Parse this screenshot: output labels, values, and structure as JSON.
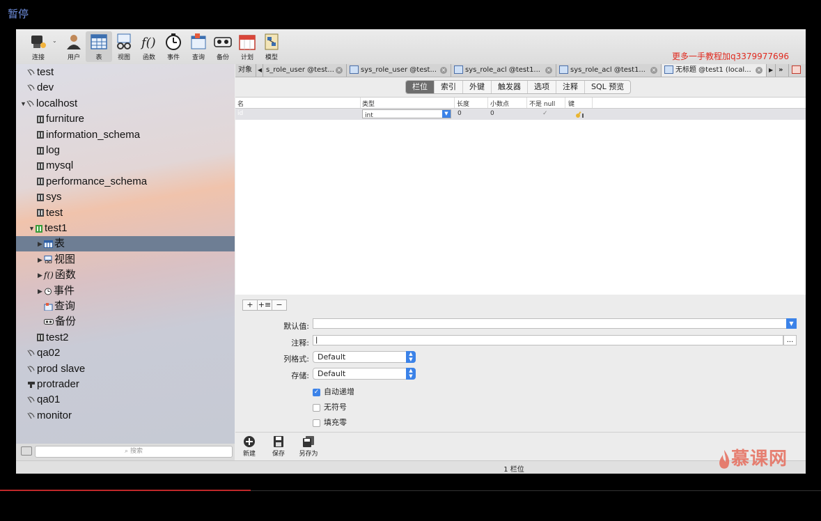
{
  "player": {
    "pause_label": "暂停",
    "progress": 0.305,
    "accent": "#c0282a"
  },
  "watermark": "更多一手教程加q3379977696",
  "toolbar": {
    "items": [
      {
        "label": "连接",
        "icon": "connect-icon"
      },
      {
        "label": "用户",
        "icon": "user-icon"
      },
      {
        "label": "表",
        "icon": "table-icon",
        "active": true
      },
      {
        "label": "视图",
        "icon": "view-icon"
      },
      {
        "label": "函数",
        "icon": "function-icon"
      },
      {
        "label": "事件",
        "icon": "event-icon"
      },
      {
        "label": "查询",
        "icon": "query-icon"
      },
      {
        "label": "备份",
        "icon": "backup-icon"
      },
      {
        "label": "计划",
        "icon": "schedule-icon"
      },
      {
        "label": "模型",
        "icon": "model-icon"
      }
    ]
  },
  "sidebar": {
    "items": [
      {
        "label": "test",
        "kind": "connection",
        "level": 0
      },
      {
        "label": "dev",
        "kind": "connection",
        "level": 0
      },
      {
        "label": "localhost",
        "kind": "connection",
        "level": 0,
        "expanded": true
      },
      {
        "label": "furniture",
        "kind": "database",
        "level": 1
      },
      {
        "label": "information_schema",
        "kind": "database",
        "level": 1
      },
      {
        "label": "log",
        "kind": "database",
        "level": 1
      },
      {
        "label": "mysql",
        "kind": "database",
        "level": 1
      },
      {
        "label": "performance_schema",
        "kind": "database",
        "level": 1
      },
      {
        "label": "sys",
        "kind": "database",
        "level": 1
      },
      {
        "label": "test",
        "kind": "database",
        "level": 1
      },
      {
        "label": "test1",
        "kind": "database-open",
        "level": 1,
        "expanded": true
      },
      {
        "label": "表",
        "kind": "tables",
        "level": 2,
        "selected": true
      },
      {
        "label": "视图",
        "kind": "views",
        "level": 2
      },
      {
        "label": "函数",
        "kind": "functions",
        "level": 2
      },
      {
        "label": "事件",
        "kind": "events",
        "level": 2
      },
      {
        "label": "查询",
        "kind": "queries",
        "level": 2
      },
      {
        "label": "备份",
        "kind": "backups",
        "level": 2
      },
      {
        "label": "test2",
        "kind": "database",
        "level": 1
      },
      {
        "label": "qa02",
        "kind": "connection",
        "level": 0
      },
      {
        "label": "prod slave",
        "kind": "connection",
        "level": 0
      },
      {
        "label": "protrader",
        "kind": "connection-alt",
        "level": 0
      },
      {
        "label": "qa01",
        "kind": "connection",
        "level": 0
      },
      {
        "label": "monitor",
        "kind": "connection",
        "level": 0
      }
    ],
    "search_placeholder": "搜索"
  },
  "tabs": {
    "objects_label": "对象",
    "items": [
      {
        "label": "s_role_user @test..."
      },
      {
        "label": "sys_role_user @test..."
      },
      {
        "label": "sys_role_acl @test1..."
      },
      {
        "label": "sys_role_acl @test1..."
      },
      {
        "label": "无标题 @test1 (local...",
        "active": true
      }
    ]
  },
  "segments": [
    "栏位",
    "索引",
    "外键",
    "触发器",
    "选项",
    "注释",
    "SQL 预览"
  ],
  "grid": {
    "headers": [
      "名",
      "类型",
      "长度",
      "小数点",
      "不是 null",
      "键"
    ],
    "rows": [
      {
        "name": "id",
        "type": "int",
        "length": "0",
        "decimals": "0",
        "not_null": true,
        "key": true
      }
    ]
  },
  "row_buttons": [
    "+",
    "+≡",
    "−"
  ],
  "props": {
    "default_label": "默认值:",
    "comment_label": "注释:",
    "format_label": "列格式:",
    "format_value": "Default",
    "storage_label": "存储:",
    "storage_value": "Default",
    "more_label": "...",
    "auto_increment": "自动递增",
    "unsigned": "无符号",
    "zerofill": "填充零"
  },
  "bottom_tools": [
    {
      "label": "新建",
      "icon": "new-icon"
    },
    {
      "label": "保存",
      "icon": "save-icon"
    },
    {
      "label": "另存为",
      "icon": "save-as-icon"
    }
  ],
  "status": "1 栏位",
  "logo_text": "慕课网"
}
